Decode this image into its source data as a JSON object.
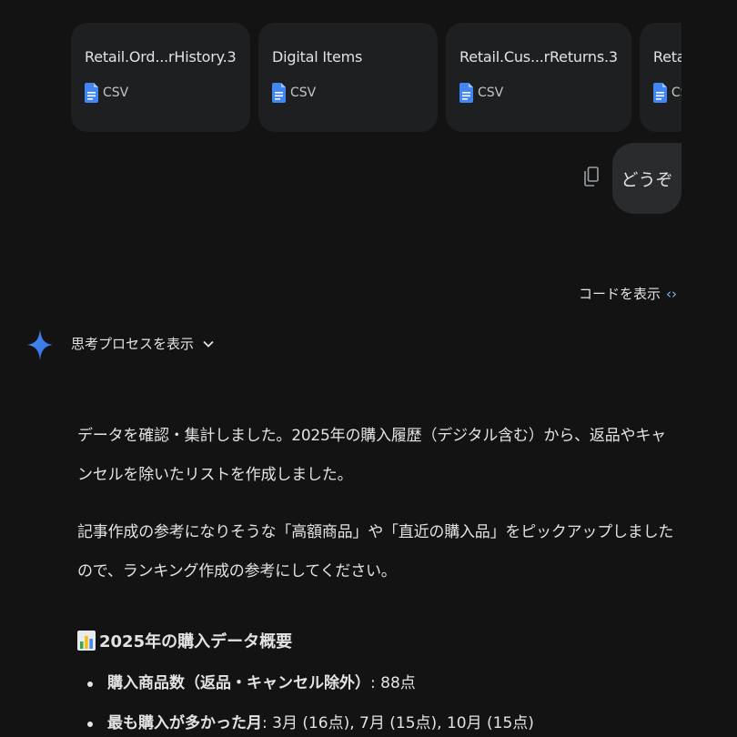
{
  "attachments": [
    {
      "name": "Retail.Ord...rHistory.3",
      "type": "CSV"
    },
    {
      "name": "Digital Items",
      "type": "CSV"
    },
    {
      "name": "Retail.Cus...rReturns.3",
      "type": "CSV"
    },
    {
      "name": "Retail.",
      "type": "CSV"
    }
  ],
  "user_message": "どうぞ",
  "show_code_label": "コードを表示",
  "thinking_label": "思考プロセスを表示",
  "response": {
    "paragraph_1": "データを確認・集計しました。2025年の購入履歴（デジタル含む）から、返品やキャンセルを除いたリストを作成しました。",
    "paragraph_2": "記事作成の参考になりそうな「高額商品」や「直近の購入品」をピックアップしましたので、ランキング作成の参考にしてください。",
    "section_heading": "2025年の購入データ概要",
    "summary": [
      {
        "label": "購入商品数（返品・キャンセル除外）",
        "value": ": 88点"
      },
      {
        "label": "最も購入が多かった月",
        "value": ": 3月 (16点), 7月 (15点), 10月 (15点)"
      }
    ]
  },
  "colors": {
    "background": "#131314",
    "card": "#1e1f20",
    "bubble": "#2a2b2d",
    "doc_icon": "#4285f4",
    "code_icon": "#8ab4f8"
  }
}
